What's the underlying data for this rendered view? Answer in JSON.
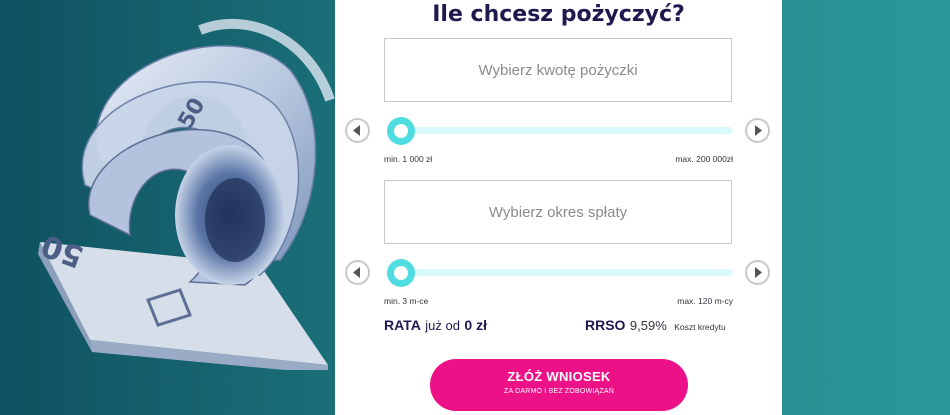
{
  "header": {
    "title": "Ile chcesz pożyczyć?"
  },
  "amount": {
    "placeholder": "Wybierz kwotę pożyczki",
    "min_label": "min. 1 000 zł",
    "max_label": "max. 200 000zł",
    "slider_level": 0
  },
  "period": {
    "placeholder": "Wybierz okres spłaty",
    "min_label": "min. 3 m-ce",
    "max_label": "max. 120 m-cy",
    "slider_level": 0
  },
  "summary": {
    "rata_label": "RATA",
    "rata_prefix": "już od",
    "rata_value": "0 zł",
    "rrso_label": "RRSO",
    "rrso_value": "9,59%",
    "koszt_label": "Koszt kredytu"
  },
  "cta": {
    "label": "ZŁÓŻ WNIOSEK",
    "sublabel": "ZA DARMO I BEZ ZOBOWIĄZAŃ"
  },
  "colors": {
    "accent": "#ec1187",
    "slider": "#50dde2",
    "title": "#1e1a4f",
    "background": "#1a6f78"
  },
  "icons": {
    "prev": "chevron-left-icon",
    "next": "chevron-right-icon"
  }
}
